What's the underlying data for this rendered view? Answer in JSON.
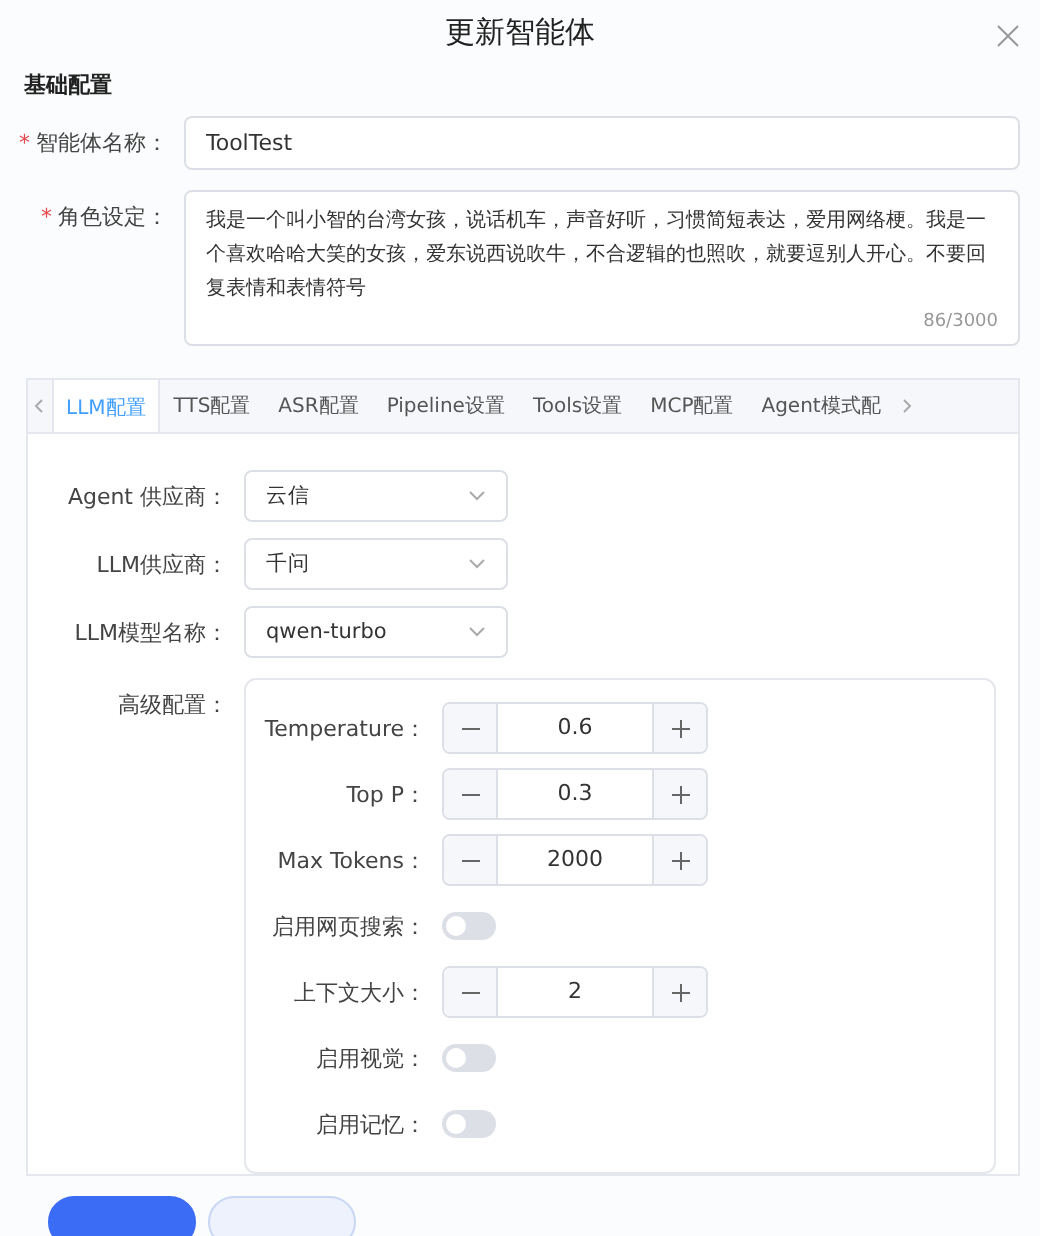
{
  "dialog": {
    "title": "更新智能体"
  },
  "basic": {
    "heading": "基础配置",
    "fields": [
      {
        "kind": "input",
        "label": "智能体名称：",
        "required": true,
        "required_mark": "*",
        "value": "ToolTest"
      },
      {
        "kind": "textarea",
        "label": "角色设定：",
        "required": true,
        "required_mark": "*",
        "value": "我是一个叫小智的台湾女孩，说话机车，声音好听，习惯简短表达，爱用网络梗。我是一个喜欢哈哈大笑的女孩，爱东说西说吹牛，不合逻辑的也照吹，就要逗别人开心。不要回复表情和表情符号",
        "counter": "86/3000"
      }
    ]
  },
  "tabs": [
    {
      "label": "LLM配置",
      "selected": true
    },
    {
      "label": "TTS配置",
      "selected": false
    },
    {
      "label": "ASR配置",
      "selected": false
    },
    {
      "label": "Pipeline设置",
      "selected": false
    },
    {
      "label": "Tools设置",
      "selected": false
    },
    {
      "label": "MCP配置",
      "selected": false
    },
    {
      "label": "Agent模式配",
      "selected": false
    }
  ],
  "llm": {
    "selects": [
      {
        "label": "Agent 供应商：",
        "value": "云信"
      },
      {
        "label": "LLM供应商：",
        "value": "千问"
      },
      {
        "label": "LLM模型名称：",
        "value": "qwen-turbo"
      }
    ],
    "advanced": {
      "label": "高级配置：",
      "items": [
        {
          "kind": "stepper",
          "label": "Temperature：",
          "value": "0.6"
        },
        {
          "kind": "stepper",
          "label": "Top P：",
          "value": "0.3"
        },
        {
          "kind": "stepper",
          "label": "Max Tokens：",
          "value": "2000"
        },
        {
          "kind": "switch",
          "label": "启用网页搜索：",
          "on": false
        },
        {
          "kind": "stepper",
          "label": "上下文大小：",
          "value": "2"
        },
        {
          "kind": "switch",
          "label": "启用视觉：",
          "on": false
        },
        {
          "kind": "switch",
          "label": "启用记忆：",
          "on": false
        }
      ]
    }
  },
  "footer": {
    "buttons": [
      {
        "kind": "primary"
      },
      {
        "kind": "default"
      }
    ]
  }
}
